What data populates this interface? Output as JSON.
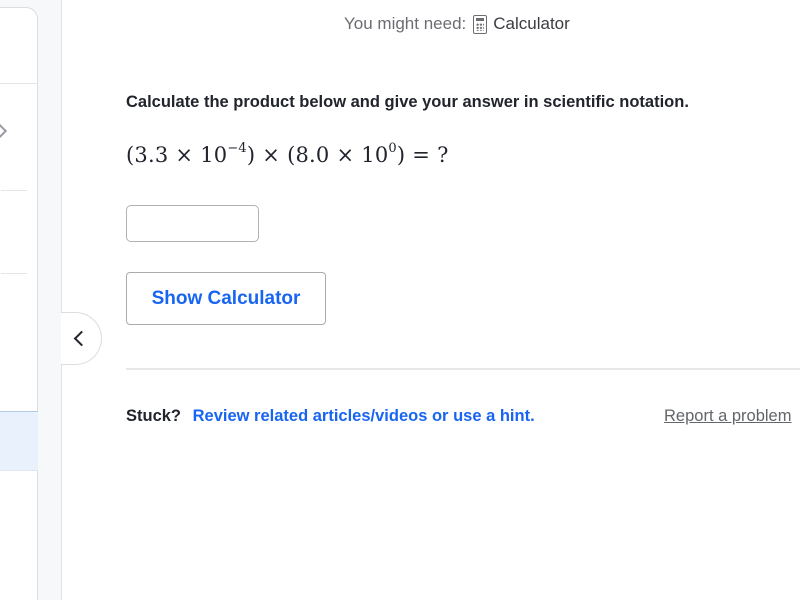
{
  "tools": {
    "prefix": "You might need:",
    "icon": "calculator-icon",
    "label": "Calculator"
  },
  "question": {
    "prompt": "Calculate the product below and give your answer in scientific notation.",
    "equation": {
      "open1": "(3.3",
      "times1": "×",
      "base1": "10",
      "exp1": "−4",
      "close1": ")",
      "times_mid": "×",
      "open2": "(8.0",
      "times2": "×",
      "base2": "10",
      "exp2": "0",
      "close2": ")",
      "equals": "=",
      "unknown": "?"
    },
    "answer_value": "",
    "answer_placeholder": ""
  },
  "buttons": {
    "show_calculator": "Show Calculator"
  },
  "footer": {
    "stuck_label": "Stuck?",
    "hint_link": "Review related articles/videos or use a hint.",
    "report_link": "Report a problem"
  },
  "sidebar": {
    "collapse_icon": "chevron-left-icon",
    "item_icon": "chevron-right-icon"
  },
  "colors": {
    "accent": "#1865f2",
    "text": "#21242c",
    "muted": "#6b6d72",
    "selected_bg": "#e9f1fd"
  }
}
